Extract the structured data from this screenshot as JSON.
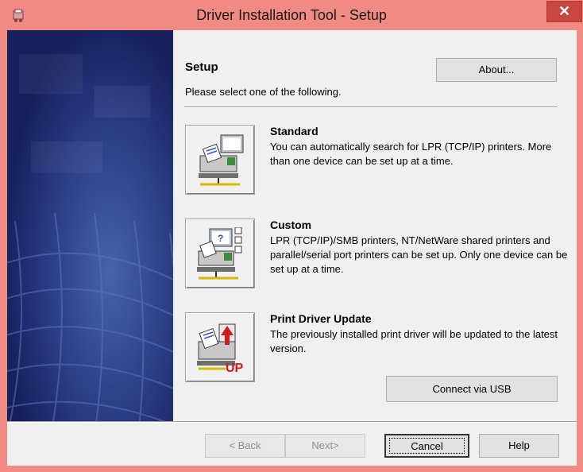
{
  "window": {
    "title": "Driver Installation Tool - Setup",
    "close_label": "✕"
  },
  "header": {
    "heading": "Setup",
    "subheading": "Please select one of the following.",
    "about_label": "About..."
  },
  "options": [
    {
      "title": "Standard",
      "description": "You can automatically search for LPR (TCP/IP) printers. More than one device can be set up at a time."
    },
    {
      "title": "Custom",
      "description": "LPR (TCP/IP)/SMB printers, NT/NetWare shared printers and parallel/serial port printers can be set up. Only one device can be set up at a time."
    },
    {
      "title": "Print Driver Update",
      "description": "The previously installed print driver will be updated to the latest version."
    }
  ],
  "usb_label": "Connect via USB",
  "footer": {
    "back_label": "< Back",
    "next_label": "Next>",
    "cancel_label": "Cancel",
    "help_label": "Help"
  },
  "colors": {
    "titlebar": "#f08a82",
    "close": "#c7463f",
    "panel": "#1e2f78"
  }
}
